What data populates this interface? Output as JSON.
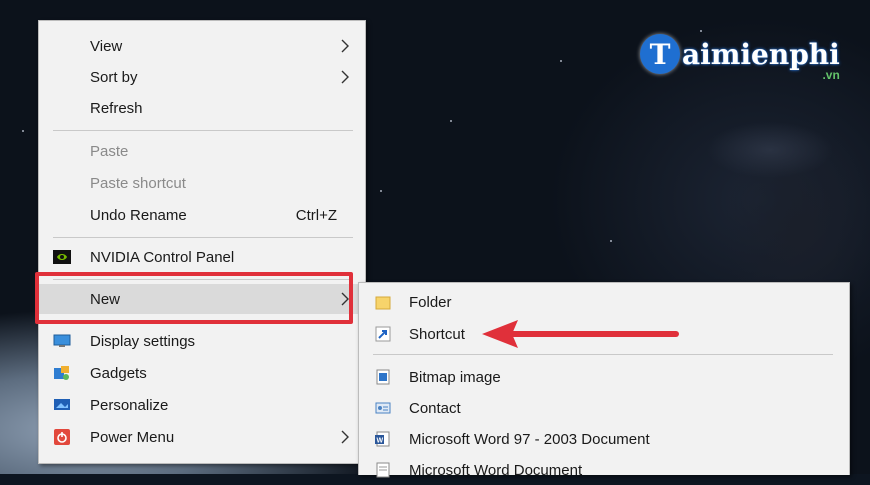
{
  "watermark": {
    "badge": "T",
    "text": "aimienphi",
    "suffix": ".vn"
  },
  "context_menu": {
    "view": "View",
    "sort_by": "Sort by",
    "refresh": "Refresh",
    "paste": "Paste",
    "paste_shortcut": "Paste shortcut",
    "undo_rename": "Undo Rename",
    "undo_shortcut": "Ctrl+Z",
    "nvidia": "NVIDIA Control Panel",
    "new": "New",
    "display_settings": "Display settings",
    "gadgets": "Gadgets",
    "personalize": "Personalize",
    "power_menu": "Power Menu"
  },
  "new_submenu": {
    "folder": "Folder",
    "shortcut": "Shortcut",
    "bitmap": "Bitmap image",
    "contact": "Contact",
    "word97": "Microsoft Word 97 - 2003 Document",
    "word": "Microsoft Word Document"
  },
  "colors": {
    "highlight_box": "#e0303a",
    "menu_bg": "#f2f2f2",
    "accent": "#1f6fd1"
  },
  "icons": [
    "nvidia-icon",
    "display-icon",
    "gadgets-icon",
    "personalize-icon",
    "power-icon",
    "folder-icon",
    "shortcut-icon",
    "bitmap-icon",
    "contact-icon",
    "word-icon"
  ]
}
